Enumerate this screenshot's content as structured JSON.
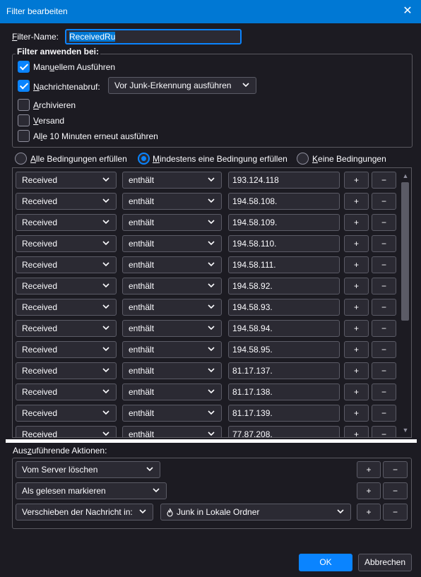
{
  "window": {
    "title": "Filter bearbeiten",
    "close_glyph": "✕"
  },
  "filter_name": {
    "label_prefix": "F",
    "label_rest": "ilter-Name:",
    "value": "ReceivedRu"
  },
  "apply_group": {
    "title": "Filter anwenden bei:",
    "manual": {
      "pre": "Man",
      "ul": "u",
      "post": "ellem Ausführen",
      "checked": true
    },
    "fetch": {
      "ul": "N",
      "post": "achrichtenabruf:",
      "checked": true,
      "select": "Vor Junk-Erkennung ausführen"
    },
    "archive": {
      "ul": "A",
      "post": "rchivieren",
      "checked": false
    },
    "send": {
      "ul": "V",
      "post": "ersand",
      "checked": false
    },
    "periodic": {
      "pre": "Al",
      "ul": "l",
      "post": "e 10 Minuten erneut ausführen",
      "checked": false
    }
  },
  "match": {
    "all": {
      "ul": "A",
      "post": "lle Bedingungen erfüllen",
      "selected": false
    },
    "any": {
      "ul": "M",
      "post": "indestens eine Bedingung erfüllen",
      "selected": true
    },
    "none": {
      "ul": "K",
      "post": "eine Bedingungen",
      "selected": false
    }
  },
  "conditions": [
    {
      "field": "Received",
      "op": "enthält",
      "value": "193.124.118"
    },
    {
      "field": "Received",
      "op": "enthält",
      "value": "194.58.108."
    },
    {
      "field": "Received",
      "op": "enthält",
      "value": "194.58.109."
    },
    {
      "field": "Received",
      "op": "enthält",
      "value": "194.58.110."
    },
    {
      "field": "Received",
      "op": "enthält",
      "value": "194.58.111."
    },
    {
      "field": "Received",
      "op": "enthält",
      "value": "194.58.92."
    },
    {
      "field": "Received",
      "op": "enthält",
      "value": "194.58.93."
    },
    {
      "field": "Received",
      "op": "enthält",
      "value": "194.58.94."
    },
    {
      "field": "Received",
      "op": "enthält",
      "value": "194.58.95."
    },
    {
      "field": "Received",
      "op": "enthält",
      "value": "81.17.137."
    },
    {
      "field": "Received",
      "op": "enthält",
      "value": "81.17.138."
    },
    {
      "field": "Received",
      "op": "enthält",
      "value": "81.17.139."
    },
    {
      "field": "Received",
      "op": "enthält",
      "value": "77.87.208."
    }
  ],
  "row_buttons": {
    "add": "+",
    "remove": "−"
  },
  "scroll": {
    "up": "▲",
    "down": "▼"
  },
  "actions": {
    "title_pre": "Aus",
    "title_ul": "z",
    "title_post": "uführende Aktionen:",
    "items": [
      {
        "label": "Vom Server löschen"
      },
      {
        "label": "Als gelesen markieren"
      },
      {
        "label": "Verschieben der Nachricht in:",
        "target": "Junk in Lokale Ordner"
      }
    ]
  },
  "footer": {
    "ok": "OK",
    "cancel": "Abbrechen"
  }
}
